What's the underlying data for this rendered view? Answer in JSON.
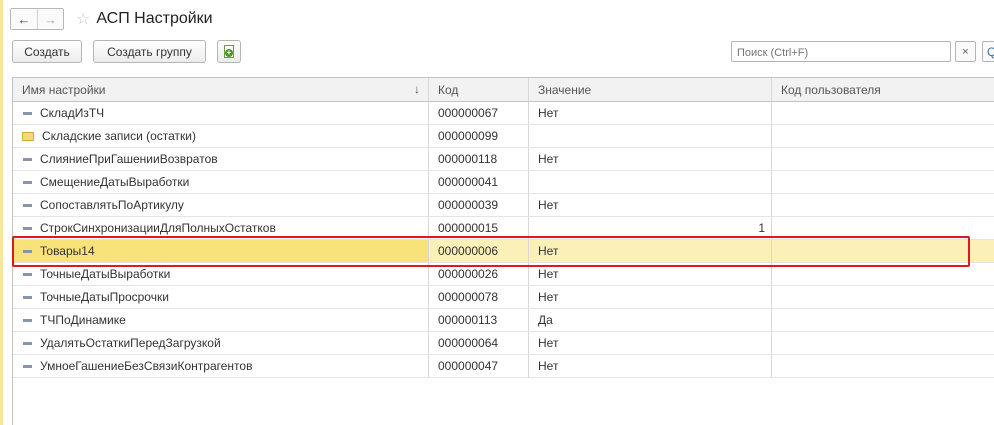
{
  "window": {
    "title": "АСП Настройки"
  },
  "nav": {
    "back_icon": "arrow-left-icon",
    "forward_icon": "arrow-right-icon",
    "favorite_icon": "star-icon"
  },
  "toolbar": {
    "create_label": "Создать",
    "create_group_label": "Создать группу",
    "copy_icon": "copy-add-icon",
    "search_placeholder": "Поиск (Ctrl+F)",
    "clear_label": "×",
    "search_button_label": "Q"
  },
  "table": {
    "columns": {
      "name": "Имя настройки",
      "code": "Код",
      "value": "Значение",
      "user_code": "Код пользователя",
      "sort_indicator": "↓"
    },
    "rows": [
      {
        "icon": "item",
        "name": "СкладИзТЧ",
        "code": "000000067",
        "value": "Нет",
        "user_code": ""
      },
      {
        "icon": "folder",
        "name": "Складские записи (остатки)",
        "code": "000000099",
        "value": "",
        "user_code": ""
      },
      {
        "icon": "item",
        "name": "СлияниеПриГашенииВозвратов",
        "code": "000000118",
        "value": "Нет",
        "user_code": ""
      },
      {
        "icon": "item",
        "name": "СмещениеДатыВыработки",
        "code": "000000041",
        "value": "",
        "user_code": ""
      },
      {
        "icon": "item",
        "name": "СопоставлятьПоАртикулу",
        "code": "000000039",
        "value": "Нет",
        "user_code": ""
      },
      {
        "icon": "item",
        "name": "СтрокСинхронизацииДляПолныхОстатков",
        "code": "000000015",
        "value": "1",
        "user_code": ""
      },
      {
        "icon": "item",
        "name": "Товары14",
        "code": "000000006",
        "value": "Нет",
        "user_code": "",
        "selected": true
      },
      {
        "icon": "item",
        "name": "ТочныеДатыВыработки",
        "code": "000000026",
        "value": "Нет",
        "user_code": ""
      },
      {
        "icon": "item",
        "name": "ТочныеДатыПросрочки",
        "code": "000000078",
        "value": "Нет",
        "user_code": ""
      },
      {
        "icon": "item",
        "name": "ТЧПоДинамике",
        "code": "000000113",
        "value": "Да",
        "user_code": ""
      },
      {
        "icon": "item",
        "name": "УдалятьОстаткиПередЗагрузкой",
        "code": "000000064",
        "value": "Нет",
        "user_code": ""
      },
      {
        "icon": "item",
        "name": "УмноеГашениеБезСвязиКонтрагентов",
        "code": "000000047",
        "value": "Нет",
        "user_code": ""
      }
    ]
  },
  "colors": {
    "selection_bg": "#fbf0b8",
    "selection_name_bg": "#f8e27a",
    "highlight_border": "#e01a1a"
  }
}
